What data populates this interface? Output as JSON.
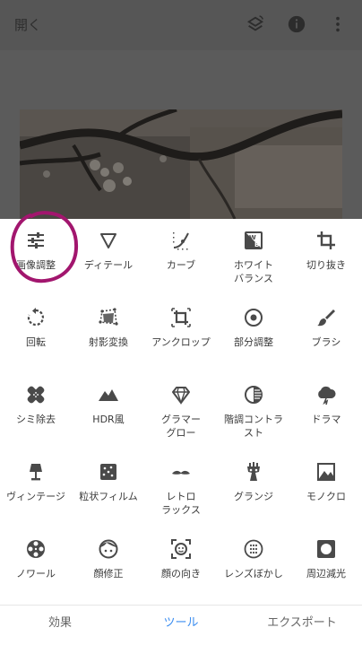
{
  "topbar": {
    "open_label": "開く"
  },
  "colors": {
    "accent": "#3d8ef0",
    "icon": "#4a4a4a",
    "annotation": "#a2166e"
  },
  "tools": [
    {
      "label": "画像調整",
      "icon": "tune-icon"
    },
    {
      "label": "ディテール",
      "icon": "triangle-down-icon"
    },
    {
      "label": "カーブ",
      "icon": "curves-icon"
    },
    {
      "label": "ホワイト\nバランス",
      "icon": "white-balance-icon"
    },
    {
      "label": "切り抜き",
      "icon": "crop-icon"
    },
    {
      "label": "回転",
      "icon": "rotate-icon"
    },
    {
      "label": "射影変換",
      "icon": "perspective-icon"
    },
    {
      "label": "アンクロップ",
      "icon": "expand-icon"
    },
    {
      "label": "部分調整",
      "icon": "selective-icon"
    },
    {
      "label": "ブラシ",
      "icon": "brush-icon"
    },
    {
      "label": "シミ除去",
      "icon": "healing-icon"
    },
    {
      "label": "HDR風",
      "icon": "hdr-icon"
    },
    {
      "label": "グラマー\nグロー",
      "icon": "glamour-glow-icon"
    },
    {
      "label": "階調コントラ\nスト",
      "icon": "tonal-contrast-icon"
    },
    {
      "label": "ドラマ",
      "icon": "drama-icon"
    },
    {
      "label": "ヴィンテージ",
      "icon": "vintage-icon"
    },
    {
      "label": "粒状フィルム",
      "icon": "grainy-film-icon"
    },
    {
      "label": "レトロ\nラックス",
      "icon": "retrolux-icon"
    },
    {
      "label": "グランジ",
      "icon": "grunge-icon"
    },
    {
      "label": "モノクロ",
      "icon": "black-white-icon"
    },
    {
      "label": "ノワール",
      "icon": "noir-icon"
    },
    {
      "label": "顔修正",
      "icon": "face-enhance-icon"
    },
    {
      "label": "顔の向き",
      "icon": "head-pose-icon"
    },
    {
      "label": "レンズぼかし",
      "icon": "lens-blur-icon"
    },
    {
      "label": "周辺減光",
      "icon": "vignette-icon"
    }
  ],
  "tabs": [
    {
      "label": "効果",
      "active": false
    },
    {
      "label": "ツール",
      "active": true
    },
    {
      "label": "エクスポート",
      "active": false
    }
  ]
}
